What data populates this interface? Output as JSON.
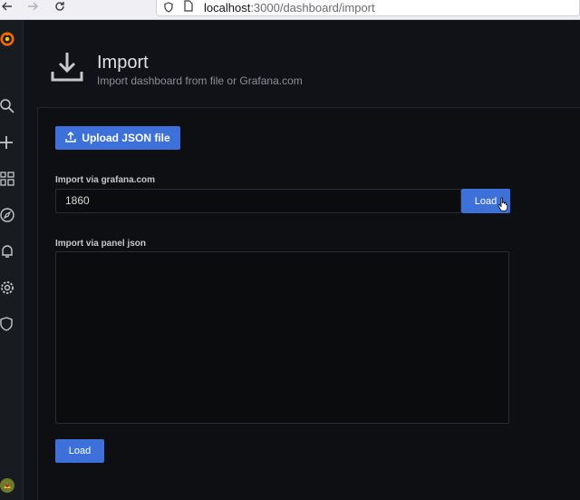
{
  "browser": {
    "url_host": "localhost",
    "url_path": ":3000/dashboard/import"
  },
  "sidebar": {
    "items": [
      {
        "icon": "grafana-logo-icon"
      },
      {
        "icon": "search-icon"
      },
      {
        "icon": "plus-icon"
      },
      {
        "icon": "dashboards-grid-icon"
      },
      {
        "icon": "explore-compass-icon"
      },
      {
        "icon": "alerting-bell-icon"
      },
      {
        "icon": "configuration-gear-icon"
      },
      {
        "icon": "server-admin-shield-icon"
      },
      {
        "icon": "user-avatar-icon"
      }
    ]
  },
  "header": {
    "title": "Import",
    "subtitle": "Import dashboard from file or Grafana.com"
  },
  "form": {
    "upload_label": "Upload JSON file",
    "gcom_label": "Import via grafana.com",
    "gcom_value": "1860",
    "gcom_load_label": "Load",
    "panel_json_label": "Import via panel json",
    "panel_json_value": "",
    "json_load_label": "Load"
  },
  "colors": {
    "primary": "#3d71d9",
    "background": "#111217",
    "sidebar": "#181b1f",
    "logo_orange": "#f46800"
  }
}
